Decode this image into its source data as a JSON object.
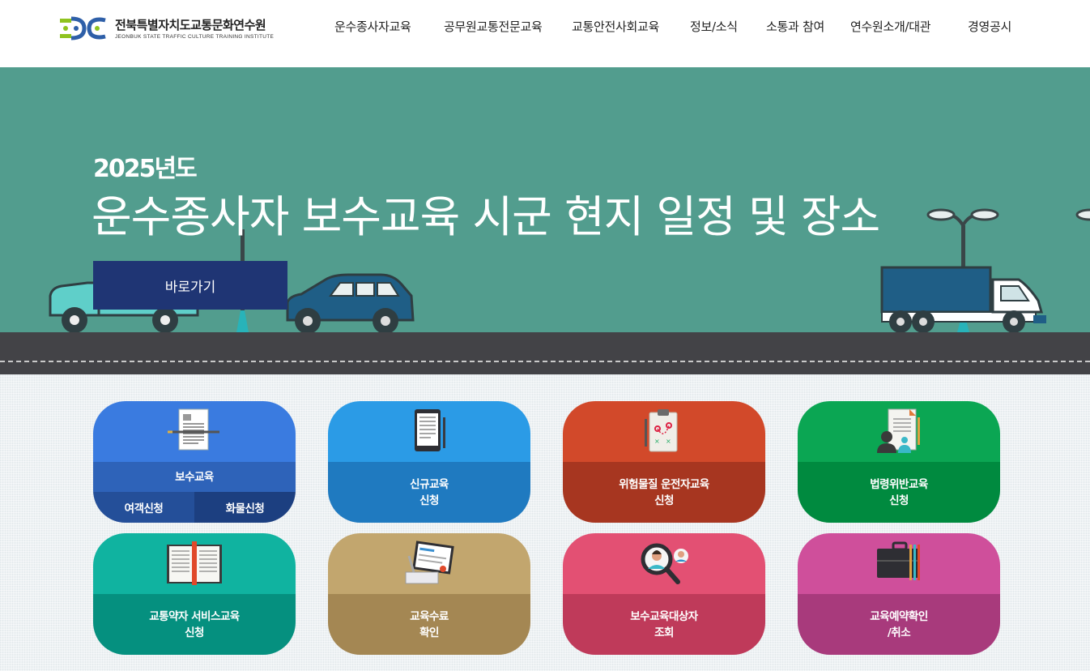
{
  "header": {
    "logo_name": "전북특별자치도교통문화연수원",
    "logo_sub": "JEONBUK STATE TRAFFIC CULTURE TRAINING INSTITUTE",
    "nav": [
      "운수종사자교육",
      "공무원교통전문교육",
      "교통안전사회교육",
      "정보/소식",
      "소통과 참여",
      "연수원소개/대관",
      "경영공시"
    ]
  },
  "hero": {
    "year": "2025년도",
    "title": "운수종사자 보수교육 시군 현지 일정 및 장소",
    "button": "바로가기"
  },
  "cards": [
    {
      "label": "보수교육",
      "sub_left": "여객신청",
      "sub_right": "화물신청",
      "icon": "document-icon",
      "top_color": "#3a7be0",
      "bottom_color": "#2e63b9"
    },
    {
      "label": "신규교육",
      "label2": "신청",
      "icon": "tablet-icon",
      "top_color": "#2b9be6",
      "bottom_color": "#1f7ac0"
    },
    {
      "label": "위험물질 운전자교육",
      "label2": "신청",
      "icon": "clipboard-icon",
      "top_color": "#d2492a",
      "bottom_color": "#a73620"
    },
    {
      "label": "법령위반교육",
      "label2": "신청",
      "icon": "contract-icon",
      "top_color": "#0ba653",
      "bottom_color": "#008a3f"
    },
    {
      "label": "교통약자 서비스교육",
      "label2": "신청",
      "icon": "book-icon",
      "top_color": "#10b3a0",
      "bottom_color": "#05907f"
    },
    {
      "label": "교육수료",
      "label2": "확인",
      "icon": "certificate-icon",
      "top_color": "#c2a66e",
      "bottom_color": "#a48753"
    },
    {
      "label": "보수교육대상자",
      "label2": "조회",
      "icon": "magnifier-person-icon",
      "top_color": "#e35073",
      "bottom_color": "#bf3a5a"
    },
    {
      "label": "교육예약확인",
      "label2": "/취소",
      "icon": "briefcase-icon",
      "top_color": "#cf4f9b",
      "bottom_color": "#a83a7c"
    }
  ]
}
